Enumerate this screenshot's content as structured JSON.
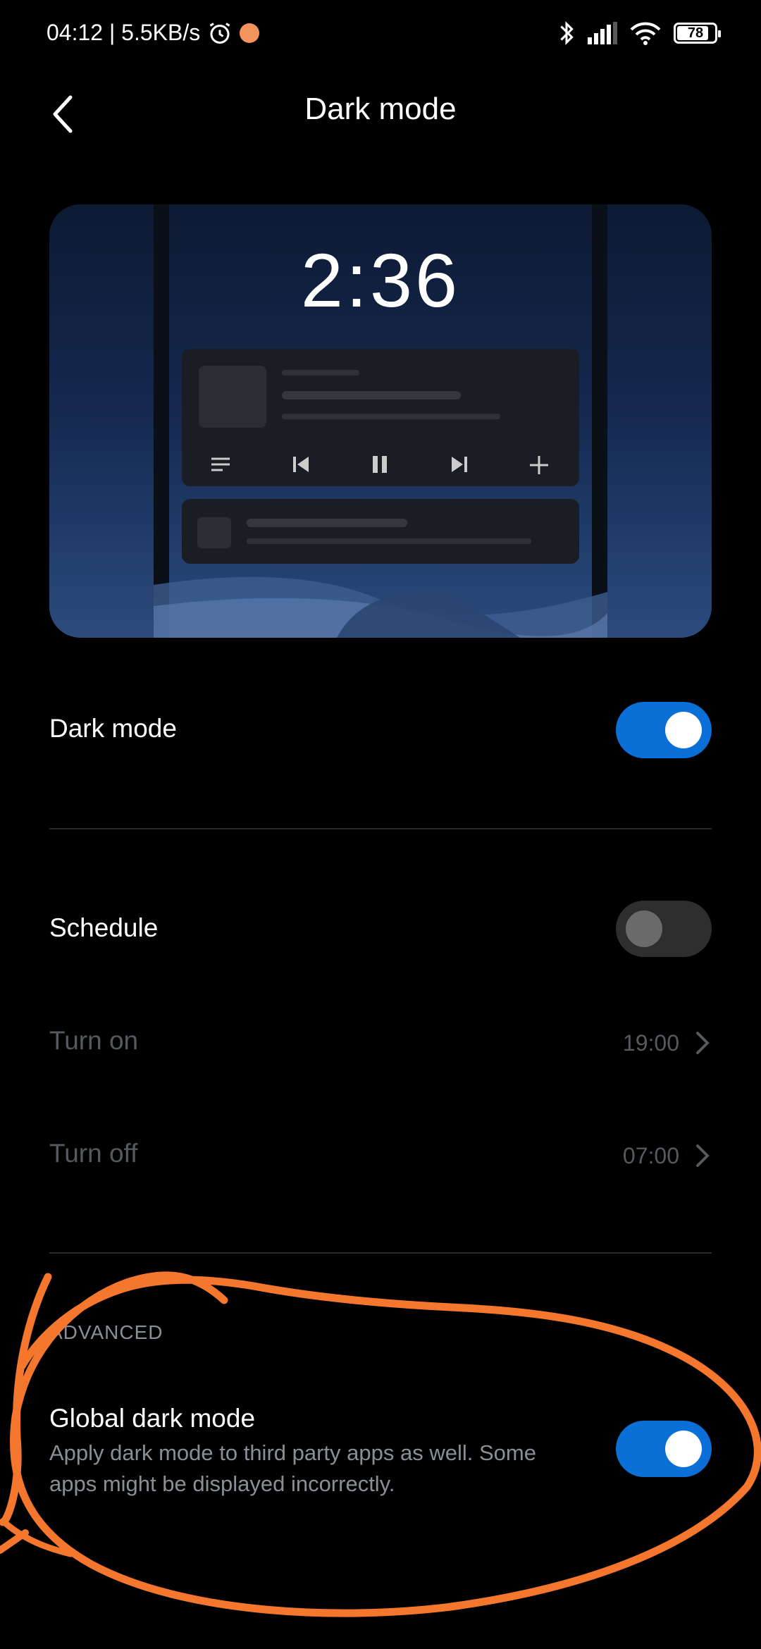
{
  "status_bar": {
    "time_speed": "04:12 | 5.5KB/s",
    "battery": "78"
  },
  "header": {
    "title": "Dark mode"
  },
  "preview": {
    "clock": "2:36"
  },
  "settings": {
    "dark_mode": {
      "label": "Dark mode",
      "enabled": true
    },
    "schedule": {
      "label": "Schedule",
      "enabled": false
    },
    "turn_on": {
      "label": "Turn on",
      "value": "19:00"
    },
    "turn_off": {
      "label": "Turn off",
      "value": "07:00"
    }
  },
  "advanced": {
    "heading": "ADVANCED",
    "global_dark_mode": {
      "label": "Global dark mode",
      "description": "Apply dark mode to third party apps as well. Some apps might be displayed incorrectly.",
      "enabled": true
    }
  },
  "colors": {
    "accent": "#0a6fd6",
    "annotation": "#f5772e",
    "background": "#000000"
  }
}
